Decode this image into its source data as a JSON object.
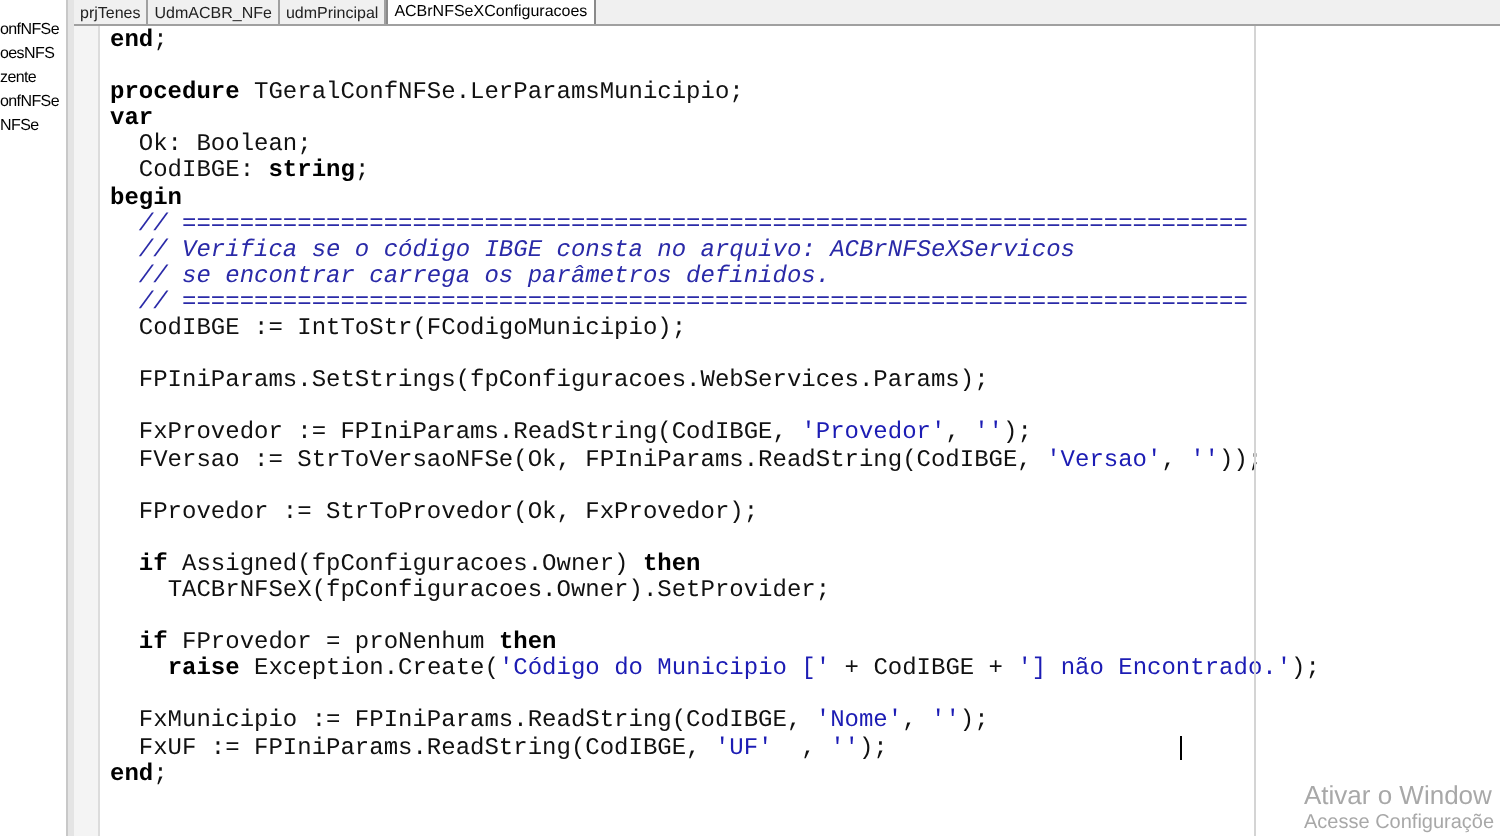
{
  "project_tree": {
    "items": [
      "onfNFSe",
      "oesNFS",
      "zente",
      "onfNFSe",
      "NFSe"
    ]
  },
  "tabs": [
    {
      "label": "prjTenes",
      "selected": false
    },
    {
      "label": "UdmACBR_NFe",
      "selected": false
    },
    {
      "label": "udmPrincipal",
      "selected": false
    },
    {
      "label": "ACBrNFSeXConfiguracoes",
      "selected": true
    }
  ],
  "code_lines": [
    {
      "kind": "code",
      "segments": [
        {
          "kind": "keyword",
          "text": "end"
        },
        {
          "kind": "plain",
          "text": ";"
        }
      ]
    },
    {
      "kind": "blank"
    },
    {
      "kind": "code",
      "segments": [
        {
          "kind": "keyword",
          "text": "procedure"
        },
        {
          "kind": "plain",
          "text": " TGeralConfNFSe.LerParamsMunicipio;"
        }
      ]
    },
    {
      "kind": "code",
      "segments": [
        {
          "kind": "keyword",
          "text": "var"
        }
      ]
    },
    {
      "kind": "code",
      "segments": [
        {
          "kind": "plain",
          "text": "  Ok: Boolean;"
        }
      ]
    },
    {
      "kind": "code",
      "segments": [
        {
          "kind": "plain",
          "text": "  CodIBGE: "
        },
        {
          "kind": "keyword",
          "text": "string"
        },
        {
          "kind": "plain",
          "text": ";"
        }
      ]
    },
    {
      "kind": "code",
      "segments": [
        {
          "kind": "keyword",
          "text": "begin"
        }
      ]
    },
    {
      "kind": "code",
      "segments": [
        {
          "kind": "comment",
          "text": "  // =========================================================================="
        }
      ]
    },
    {
      "kind": "code",
      "segments": [
        {
          "kind": "comment",
          "text": "  // Verifica se o código IBGE consta no arquivo: ACBrNFSeXServicos"
        }
      ]
    },
    {
      "kind": "code",
      "segments": [
        {
          "kind": "comment",
          "text": "  // se encontrar carrega os parâmetros definidos."
        }
      ]
    },
    {
      "kind": "code",
      "segments": [
        {
          "kind": "comment",
          "text": "  // =========================================================================="
        }
      ]
    },
    {
      "kind": "code",
      "segments": [
        {
          "kind": "plain",
          "text": "  CodIBGE := IntToStr(FCodigoMunicipio);"
        }
      ]
    },
    {
      "kind": "blank"
    },
    {
      "kind": "code",
      "segments": [
        {
          "kind": "plain",
          "text": "  FPIniParams.SetStrings(fpConfiguracoes.WebServices.Params);"
        }
      ]
    },
    {
      "kind": "blank"
    },
    {
      "kind": "code",
      "segments": [
        {
          "kind": "plain",
          "text": "  FxProvedor := FPIniParams.ReadString(CodIBGE, "
        },
        {
          "kind": "string",
          "text": "'Provedor'"
        },
        {
          "kind": "plain",
          "text": ", "
        },
        {
          "kind": "string",
          "text": "''"
        },
        {
          "kind": "plain",
          "text": ");"
        }
      ]
    },
    {
      "kind": "code",
      "segments": [
        {
          "kind": "plain",
          "text": "  FVersao := StrToVersaoNFSe(Ok, FPIniParams.ReadString(CodIBGE, "
        },
        {
          "kind": "string",
          "text": "'Versao'"
        },
        {
          "kind": "plain",
          "text": ", "
        },
        {
          "kind": "string",
          "text": "''"
        },
        {
          "kind": "plain",
          "text": "));"
        }
      ]
    },
    {
      "kind": "blank"
    },
    {
      "kind": "code",
      "segments": [
        {
          "kind": "plain",
          "text": "  FProvedor := StrToProvedor(Ok, FxProvedor);"
        }
      ]
    },
    {
      "kind": "blank"
    },
    {
      "kind": "code",
      "segments": [
        {
          "kind": "keyword",
          "text": "  if"
        },
        {
          "kind": "plain",
          "text": " Assigned(fpConfiguracoes.Owner) "
        },
        {
          "kind": "keyword",
          "text": "then"
        }
      ]
    },
    {
      "kind": "code",
      "segments": [
        {
          "kind": "plain",
          "text": "    TACBrNFSeX(fpConfiguracoes.Owner).SetProvider;"
        }
      ]
    },
    {
      "kind": "blank"
    },
    {
      "kind": "code",
      "segments": [
        {
          "kind": "keyword",
          "text": "  if"
        },
        {
          "kind": "plain",
          "text": " FProvedor = proNenhum "
        },
        {
          "kind": "keyword",
          "text": "then"
        }
      ]
    },
    {
      "kind": "code",
      "segments": [
        {
          "kind": "keyword",
          "text": "    raise"
        },
        {
          "kind": "plain",
          "text": " Exception.Create("
        },
        {
          "kind": "string",
          "text": "'Código do Municipio ['"
        },
        {
          "kind": "plain",
          "text": " + CodIBGE + "
        },
        {
          "kind": "string",
          "text": "'] não Encontrado.'"
        },
        {
          "kind": "plain",
          "text": ");"
        }
      ]
    },
    {
      "kind": "blank"
    },
    {
      "kind": "code",
      "segments": [
        {
          "kind": "plain",
          "text": "  FxMunicipio := FPIniParams.ReadString(CodIBGE, "
        },
        {
          "kind": "string",
          "text": "'Nome'"
        },
        {
          "kind": "plain",
          "text": ", "
        },
        {
          "kind": "string",
          "text": "''"
        },
        {
          "kind": "plain",
          "text": ");"
        }
      ]
    },
    {
      "kind": "code",
      "segments": [
        {
          "kind": "plain",
          "text": "  FxUF := FPIniParams.ReadString(CodIBGE, "
        },
        {
          "kind": "string",
          "text": "'UF'"
        },
        {
          "kind": "plain",
          "text": "  , "
        },
        {
          "kind": "string",
          "text": "''"
        },
        {
          "kind": "plain",
          "text": ");"
        }
      ]
    },
    {
      "kind": "code",
      "segments": [
        {
          "kind": "keyword",
          "text": "end"
        },
        {
          "kind": "plain",
          "text": ";"
        }
      ]
    }
  ],
  "activation_notice": {
    "title": "Ativar o Window",
    "subtitle": "Acesse Configuraçõe"
  }
}
